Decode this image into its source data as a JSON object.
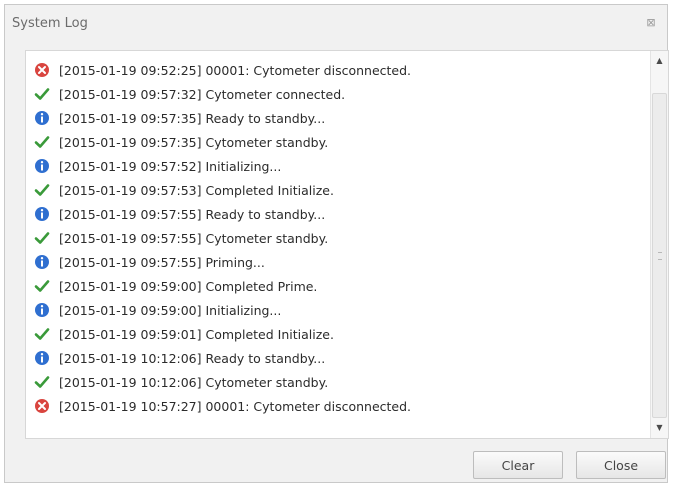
{
  "window": {
    "title": "System Log",
    "close_glyph": "⊠"
  },
  "log": {
    "entries": [
      {
        "type": "error",
        "text": "[2015-01-19 09:52:25] 00001: Cytometer disconnected."
      },
      {
        "type": "success",
        "text": "[2015-01-19 09:57:32] Cytometer connected."
      },
      {
        "type": "info",
        "text": "[2015-01-19 09:57:35] Ready to standby..."
      },
      {
        "type": "success",
        "text": "[2015-01-19 09:57:35] Cytometer standby."
      },
      {
        "type": "info",
        "text": "[2015-01-19 09:57:52] Initializing..."
      },
      {
        "type": "success",
        "text": "[2015-01-19 09:57:53] Completed Initialize."
      },
      {
        "type": "info",
        "text": "[2015-01-19 09:57:55] Ready to standby..."
      },
      {
        "type": "success",
        "text": "[2015-01-19 09:57:55] Cytometer standby."
      },
      {
        "type": "info",
        "text": "[2015-01-19 09:57:55] Priming..."
      },
      {
        "type": "success",
        "text": "[2015-01-19 09:59:00] Completed Prime."
      },
      {
        "type": "info",
        "text": "[2015-01-19 09:59:00] Initializing..."
      },
      {
        "type": "success",
        "text": "[2015-01-19 09:59:01] Completed Initialize."
      },
      {
        "type": "info",
        "text": "[2015-01-19 10:12:06] Ready to standby..."
      },
      {
        "type": "success",
        "text": "[2015-01-19 10:12:06] Cytometer standby."
      },
      {
        "type": "error",
        "text": "[2015-01-19 10:57:27] 00001: Cytometer disconnected."
      }
    ]
  },
  "icons": {
    "error": {
      "name": "error-icon",
      "color": "#d9453f"
    },
    "success": {
      "name": "checkmark-icon",
      "color": "#3a9a3a"
    },
    "info": {
      "name": "info-icon",
      "color": "#2f6fd0"
    }
  },
  "buttons": {
    "clear_label": "Clear",
    "close_label": "Close"
  }
}
